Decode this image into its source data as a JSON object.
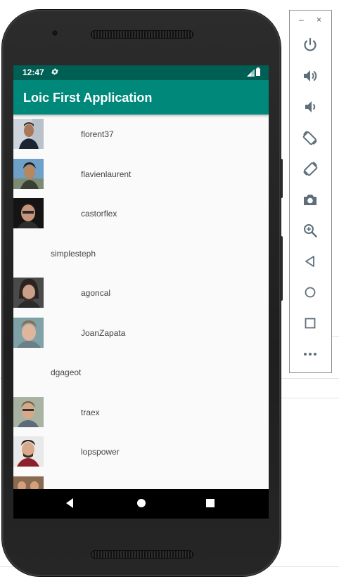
{
  "status_bar": {
    "time": "12:47"
  },
  "app_bar": {
    "title": "Loic First Application"
  },
  "users": [
    {
      "name": "florent37",
      "has_avatar": true
    },
    {
      "name": "flavienlaurent",
      "has_avatar": true
    },
    {
      "name": "castorflex",
      "has_avatar": true
    },
    {
      "name": "simplesteph",
      "has_avatar": false
    },
    {
      "name": "agoncal",
      "has_avatar": true
    },
    {
      "name": "JoanZapata",
      "has_avatar": true
    },
    {
      "name": "dgageot",
      "has_avatar": false
    },
    {
      "name": "traex",
      "has_avatar": true
    },
    {
      "name": "lopspower",
      "has_avatar": true
    }
  ],
  "emulator_panel": {
    "minimize": "–",
    "close": "×",
    "tools": [
      "power-icon",
      "volume-up-icon",
      "volume-down-icon",
      "rotate-left-icon",
      "rotate-right-icon",
      "camera-icon",
      "zoom-icon",
      "back-icon",
      "home-icon",
      "overview-icon",
      "more-icon"
    ]
  },
  "colors": {
    "primary": "#00897b",
    "primary_dark": "#005f54",
    "list_background": "#fafafa",
    "text": "#444444"
  }
}
